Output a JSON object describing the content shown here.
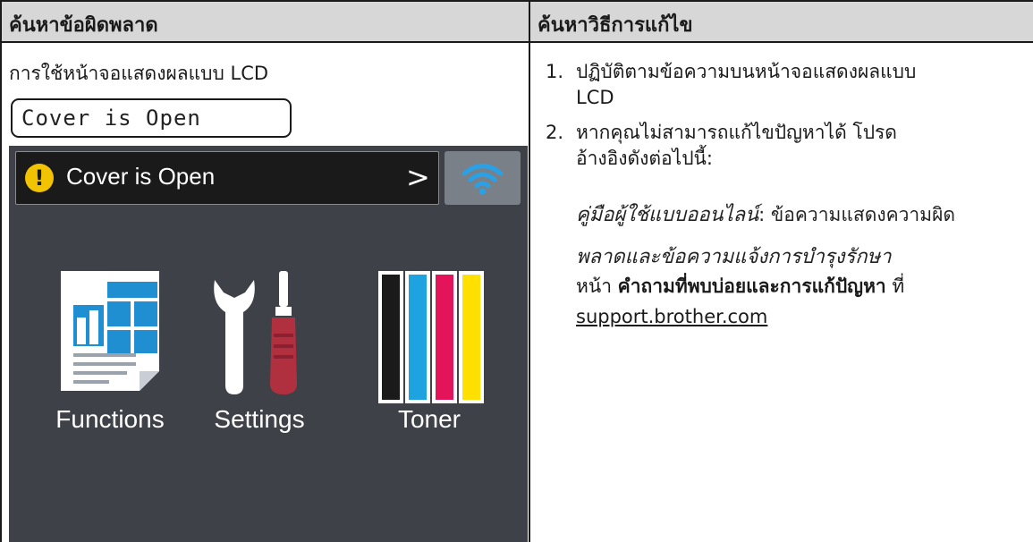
{
  "table": {
    "header_left": "ค้นหาข้อผิดพลาด",
    "header_right": "ค้นหาวิธีการแก้ไข"
  },
  "left": {
    "lcd_label": "การใช้หน้าจอแสดงผลแบบ LCD",
    "lcd_text": "Cover is Open",
    "screen": {
      "status_text": "Cover is Open",
      "warn_glyph": "!",
      "chevron_glyph": ">",
      "tiles": [
        {
          "label": "Functions",
          "icon": "functions-document-icon"
        },
        {
          "label": "Settings",
          "icon": "wrench-screwdriver-icon"
        },
        {
          "label": "Toner",
          "icon": "toner-bars-icon"
        }
      ],
      "colors": {
        "background": "#3e4148",
        "status_bar": "#1a1a1a",
        "warning": "#f2c300",
        "wifi_button": "#7a8087",
        "toner_black": "#1a1a1a",
        "toner_cyan": "#1fa3e0",
        "toner_magenta": "#e4145a",
        "toner_yellow": "#ffe000"
      }
    }
  },
  "right": {
    "step1_num": "1.",
    "step1_line1": "ปฏิบัติตามข้อความบนหน้าจอแสดงผลแบบ",
    "step1_line2": "LCD",
    "step2_num": "2.",
    "step2_line1": "หากคุณไม่สามารถแก้ไขปัญหาได้ โปรด",
    "step2_line2": "อ้างอิงดังต่อไปนี้:",
    "ref_italic_1": "คู่มือผู้ใช้แบบออนไลน์",
    "ref_italic_1_suffix": ": ข้อความแสดงความผิด",
    "ref_italic_2": "พลาดและข้อความแจ้งการบำรุงรักษา",
    "ref_page_prefix": "หน้า ",
    "ref_page_bold": "คำถามที่พบบ่อยและการแก้ปัญหา",
    "ref_page_suffix": " ที่",
    "support_url": "support.brother.com"
  }
}
